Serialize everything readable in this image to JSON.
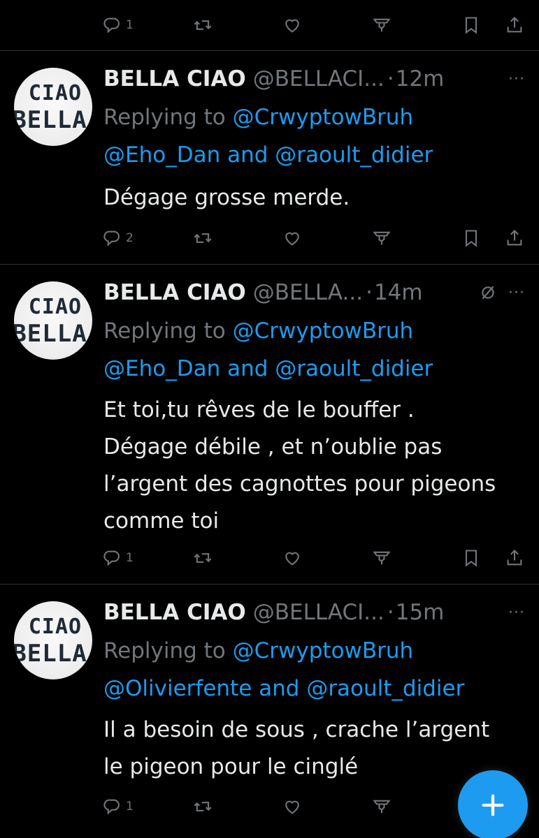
{
  "colors": {
    "background": "#000000",
    "text_primary": "#e7e9ea",
    "text_secondary": "#71767b",
    "link": "#1d9bf0",
    "divider": "#2f3336",
    "fab": "#1d9bf0"
  },
  "top_actions": {
    "reply_count": "1",
    "icons": [
      "reply-icon",
      "retweet-icon",
      "like-icon",
      "views-icon",
      "bookmark-icon",
      "share-icon"
    ]
  },
  "tweets": [
    {
      "avatar_text": [
        "CIAO",
        "BELLA"
      ],
      "name": "BELLA CIAO",
      "handle": "@BELLACI...",
      "separator": "·",
      "time": "12m",
      "more": "···",
      "replying_prefix": "Replying to",
      "replying_mention_1": "@CrwyptowBruh",
      "replying_mention_2": "@Eho_Dan",
      "replying_and": "and",
      "replying_mention_3": "@raoult_didier",
      "body": [
        "Dégage grosse merde."
      ],
      "reply_count": "2"
    },
    {
      "avatar_text": [
        "CIAO",
        "BELLA"
      ],
      "name": "BELLA CIAO",
      "handle": "@BELLA...",
      "separator": "·",
      "time": "14m",
      "more": "···",
      "replying_prefix": "Replying to",
      "replying_mention_1": "@CrwyptowBruh",
      "replying_mention_2": "@Eho_Dan",
      "replying_and": "and",
      "replying_mention_3": "@raoult_didier",
      "body": [
        "Et toi,tu rêves de le bouffer .",
        "Dégage débile , et n’oublie pas",
        "l’argent des cagnottes pour pigeons",
        "comme toi"
      ],
      "reply_count": "1"
    },
    {
      "avatar_text": [
        "CIAO",
        "BELLA"
      ],
      "name": "BELLA CIAO",
      "handle": "@BELLACI...",
      "separator": "·",
      "time": "15m",
      "more": "···",
      "replying_prefix": "Replying to",
      "replying_mention_1": "@CrwyptowBruh",
      "replying_mention_2": "@Olivierfente",
      "replying_and": "and",
      "replying_mention_3": "@raoult_didier",
      "body": [
        "Il a besoin de sous , crache l’argent",
        "le pigeon pour le cinglé"
      ],
      "reply_count": "1"
    }
  ],
  "fab": {
    "icon": "plus-icon"
  }
}
